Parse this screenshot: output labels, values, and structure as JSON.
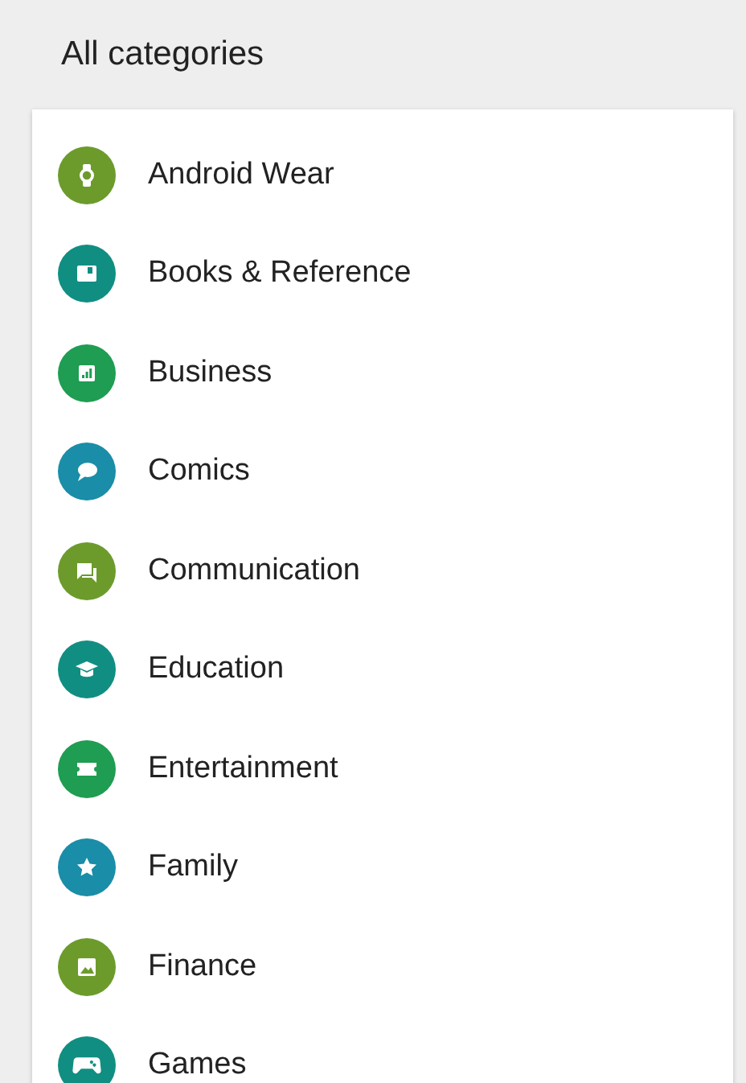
{
  "header": {
    "title": "All categories"
  },
  "categories": [
    {
      "label": "Android Wear",
      "color": "#6c9b2c"
    },
    {
      "label": "Books & Reference",
      "color": "#118e82"
    },
    {
      "label": "Business",
      "color": "#1f9d52"
    },
    {
      "label": "Comics",
      "color": "#1a8da8"
    },
    {
      "label": "Communication",
      "color": "#6c9b2c"
    },
    {
      "label": "Education",
      "color": "#118e82"
    },
    {
      "label": "Entertainment",
      "color": "#1f9d52"
    },
    {
      "label": "Family",
      "color": "#1a8da8"
    },
    {
      "label": "Finance",
      "color": "#6c9b2c"
    },
    {
      "label": "Games",
      "color": "#118e82"
    }
  ]
}
